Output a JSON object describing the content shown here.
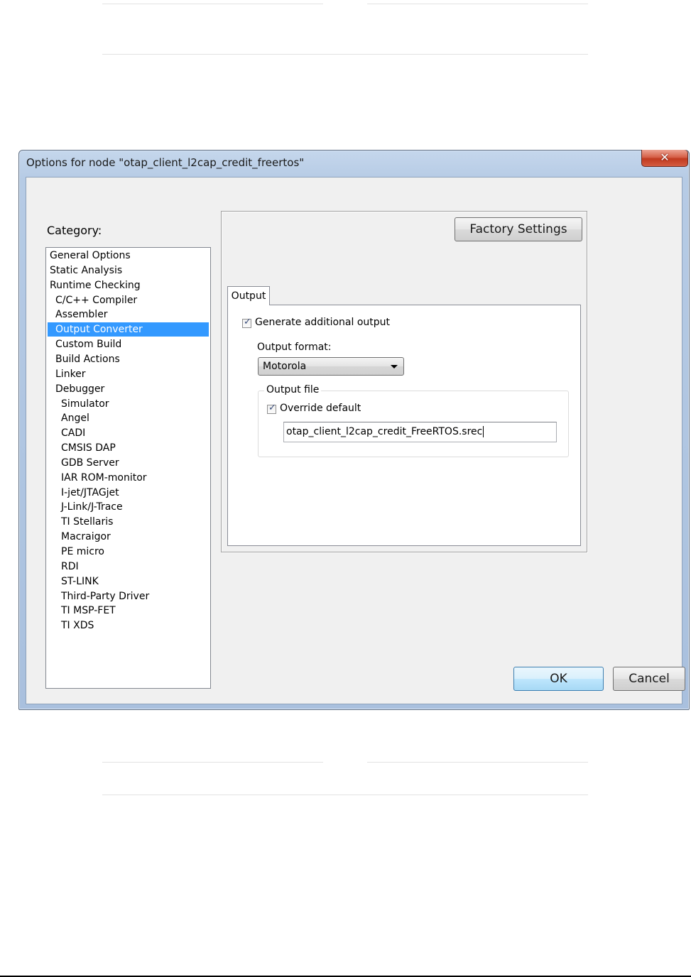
{
  "window": {
    "title": "Options for node \"otap_client_l2cap_credit_freertos\"",
    "close_glyph": "✕"
  },
  "category": {
    "label": "Category:",
    "items": [
      {
        "label": "General Options",
        "indent": 0
      },
      {
        "label": "Static Analysis",
        "indent": 0
      },
      {
        "label": "Runtime Checking",
        "indent": 0
      },
      {
        "label": "C/C++ Compiler",
        "indent": 1
      },
      {
        "label": "Assembler",
        "indent": 1
      },
      {
        "label": "Output Converter",
        "indent": 1,
        "selected": true
      },
      {
        "label": "Custom Build",
        "indent": 1
      },
      {
        "label": "Build Actions",
        "indent": 1
      },
      {
        "label": "Linker",
        "indent": 1
      },
      {
        "label": "Debugger",
        "indent": 1
      },
      {
        "label": "Simulator",
        "indent": 2
      },
      {
        "label": "Angel",
        "indent": 2
      },
      {
        "label": "CADI",
        "indent": 2
      },
      {
        "label": "CMSIS DAP",
        "indent": 2
      },
      {
        "label": "GDB Server",
        "indent": 2
      },
      {
        "label": "IAR ROM-monitor",
        "indent": 2
      },
      {
        "label": "I-jet/JTAGjet",
        "indent": 2
      },
      {
        "label": "J-Link/J-Trace",
        "indent": 2
      },
      {
        "label": "TI Stellaris",
        "indent": 2
      },
      {
        "label": "Macraigor",
        "indent": 2
      },
      {
        "label": "PE micro",
        "indent": 2
      },
      {
        "label": "RDI",
        "indent": 2
      },
      {
        "label": "ST-LINK",
        "indent": 2
      },
      {
        "label": "Third-Party Driver",
        "indent": 2
      },
      {
        "label": "TI MSP-FET",
        "indent": 2
      },
      {
        "label": "TI XDS",
        "indent": 2
      }
    ]
  },
  "panel": {
    "factory_settings_label": "Factory Settings",
    "tab_label": "Output",
    "generate_output": {
      "label": "Generate additional output",
      "checked": true
    },
    "output_format": {
      "label": "Output format:",
      "value": "Motorola"
    },
    "output_file": {
      "group_label": "Output file",
      "override": {
        "label": "Override default",
        "checked": true
      },
      "filename": "otap_client_l2cap_credit_FreeRTOS.srec"
    }
  },
  "buttons": {
    "ok": "OK",
    "cancel": "Cancel"
  },
  "colors": {
    "selection": "#3399ff",
    "close_button": "#c7432a"
  }
}
